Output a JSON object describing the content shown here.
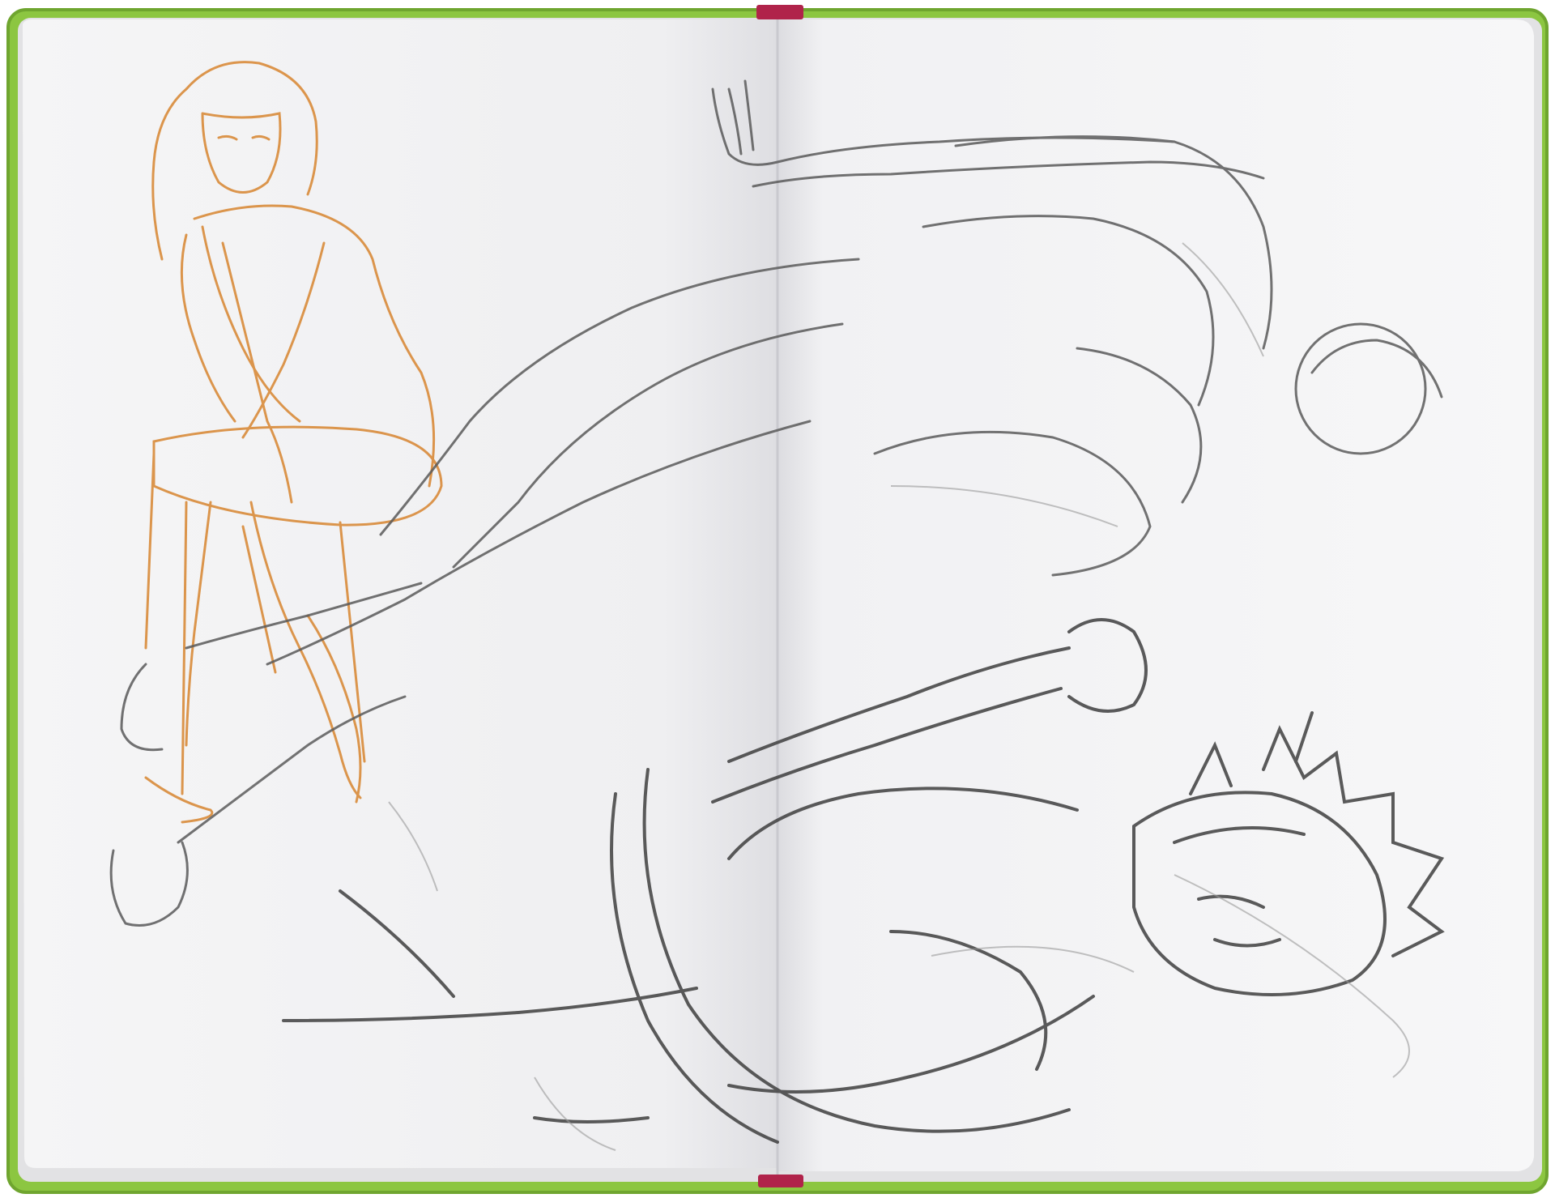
{
  "scene": {
    "subject": "open-sketchbook",
    "colors": {
      "background": "#ffffff",
      "cover": "#8cc641",
      "cover_edge": "#6fa52f",
      "bookmark_ribbon": "#b0234a",
      "page": "#f3f3f4",
      "page_left_shade": "#ececee",
      "page_edges": "#e2e2e4",
      "gutter": "#c9c9cf",
      "pencil_graphite": "#4a4a4a",
      "pencil_light": "#8a8a8a",
      "colored_pencil_orange": "#d98b3a"
    },
    "drawings": [
      "orange-seated-figure-sketch",
      "graphite-reclining-figure-sketch",
      "graphite-crouching-figure-sketch"
    ]
  }
}
